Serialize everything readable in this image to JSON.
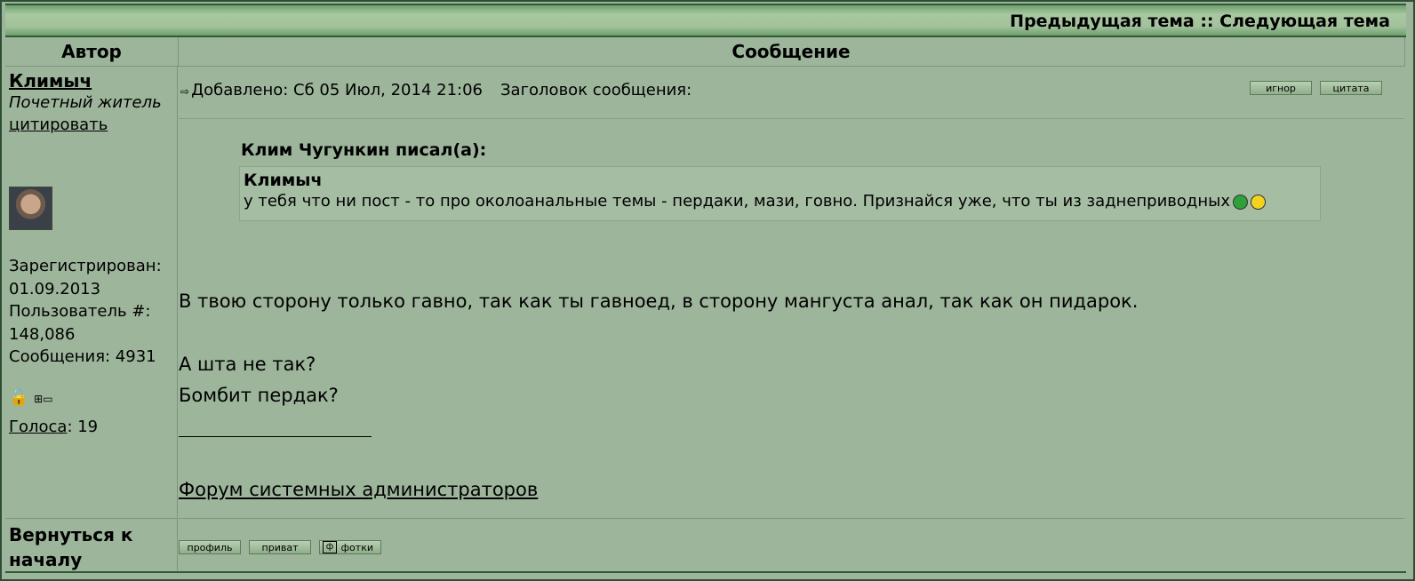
{
  "topnav": {
    "prev": "Предыдущая тема",
    "sep": " :: ",
    "next": "Следующая тема"
  },
  "headers": {
    "author": "Автор",
    "message": "Сообщение"
  },
  "author": {
    "name": "Климыч",
    "rank": "Почетный житель",
    "quote_link": "цитировать",
    "registered_label": "Зарегистрирован:",
    "registered_value": "01.09.2013",
    "user_num_label": "Пользователь #:",
    "user_num_value": "148,086",
    "messages_label": "Сообщения: 4931",
    "votes_label": "Голоса",
    "votes_value": ": 19"
  },
  "post": {
    "posted": "Добавлено: Сб 05 Июл, 2014 21:06",
    "subject_label": "Заголовок сообщения:",
    "buttons": {
      "ignore": "игнор",
      "quote": "цитата"
    },
    "quote_header": "Клим Чугункин писал(а):",
    "inner_quote_author": "Климыч",
    "inner_quote_text": "у тебя что ни пост - то про околоанальные темы - пердаки, мази, говно. Признайся уже, что ты из заднеприводных",
    "body_lines": [
      "В твою сторону только гавно, так как ты гавноед, в сторону мангуста анал, так как он пидарок.",
      "А шта не так?",
      "Бомбит пердак?"
    ],
    "signature": "Форум системных администраторов"
  },
  "footer": {
    "back_to_top": "Вернуться к началу",
    "buttons": {
      "profile": "профиль",
      "pm": "приват",
      "photos": "фотки"
    }
  }
}
